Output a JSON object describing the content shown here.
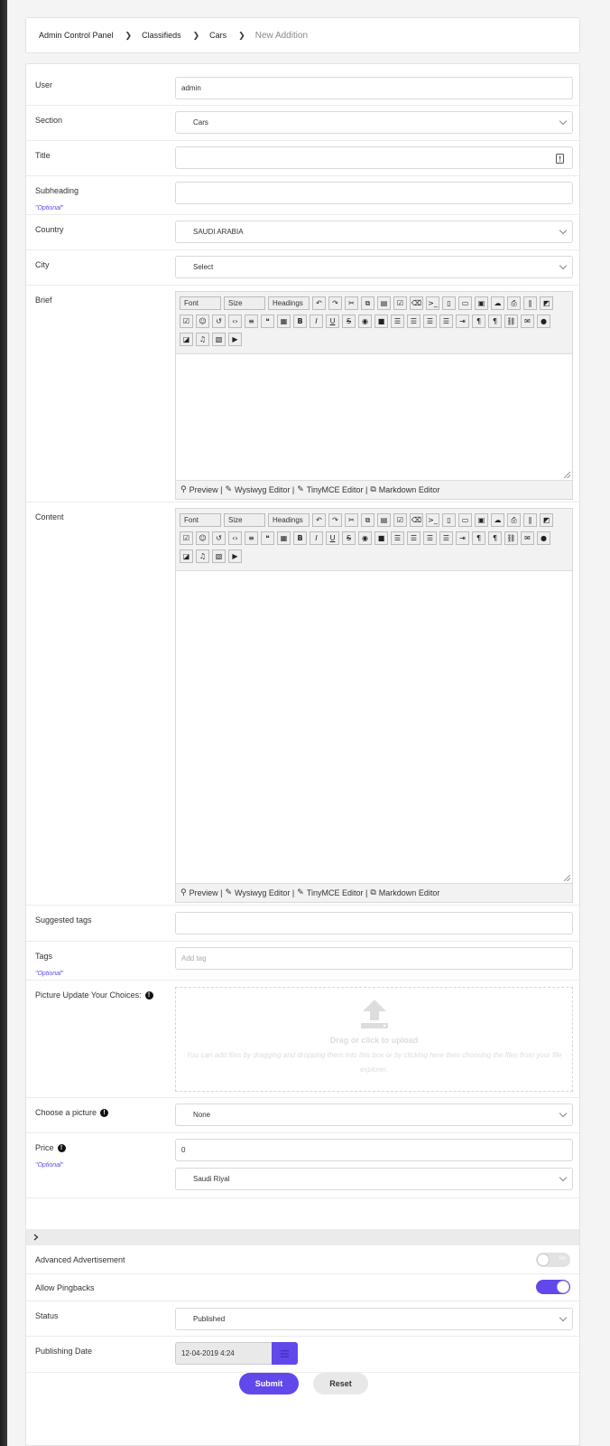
{
  "breadcrumb": {
    "items": [
      "Admin Control Panel",
      "Classifieds",
      "Cars"
    ],
    "current": "New Addition"
  },
  "form": {
    "user": {
      "label": "User",
      "value": "admin"
    },
    "section": {
      "label": "Section",
      "value": "Cars"
    },
    "title": {
      "label": "Title",
      "value": ""
    },
    "subheading": {
      "label": "Subheading",
      "optional": "\"Optional\"",
      "value": ""
    },
    "country": {
      "label": "Country",
      "value": "SAUDI ARABIA"
    },
    "city": {
      "label": "City",
      "value": "Select"
    },
    "brief": {
      "label": "Brief"
    },
    "content": {
      "label": "Content"
    },
    "suggested_tags": {
      "label": "Suggested tags",
      "value": ""
    },
    "tags": {
      "label": "Tags",
      "optional": "\"Optional\"",
      "placeholder": "Add tag"
    },
    "picture_upload": {
      "label": "Picture Update Your Choices:",
      "title": "Drag or click to upload",
      "description": "You can add files by dragging and dropping them into this box or by clicking here then choosing the files from your file explorer."
    },
    "choose_picture": {
      "label": "Choose a picture",
      "value": "None"
    },
    "price": {
      "label": "Price",
      "optional": "\"Optional\"",
      "value": "0",
      "currency": "Saudi Riyal"
    },
    "advanced_ad": {
      "label": "Advanced Advertisement",
      "toggle_text": "No",
      "state": "off"
    },
    "pingbacks": {
      "label": "Allow Pingbacks",
      "state": "on"
    },
    "status": {
      "label": "Status",
      "value": "Published"
    },
    "publishing_date": {
      "label": "Publishing Date",
      "value": "12-04-2019 4:24"
    }
  },
  "editor": {
    "dropdowns": [
      "Font",
      "Size",
      "Headings"
    ],
    "icons": [
      "undo-icon",
      "redo-icon",
      "cut-icon",
      "copy-icon",
      "paste-icon",
      "paste-text-icon",
      "eraser-icon",
      "code-view-icon",
      "file-icon",
      "frame-icon",
      "image-icon",
      "upload-icon",
      "print-icon",
      "attach-icon",
      "image-edit-icon",
      "check-square-icon",
      "emoji-icon",
      "history-icon",
      "code-icon",
      "list-icon",
      "quote-icon",
      "qrcode-icon",
      "bold-icon",
      "italic-icon",
      "underline-icon",
      "strikethrough-icon",
      "palette-icon",
      "block-icon",
      "align-right-icon",
      "align-center-icon",
      "align-left-icon",
      "justify-icon",
      "indent-icon",
      "ltr-icon",
      "rtl-icon",
      "link-icon",
      "envelope-icon",
      "comment-icon",
      "image2-icon",
      "music-icon",
      "film-icon",
      "youtube-icon"
    ],
    "footer": {
      "preview": "Preview |",
      "wysiwyg": "Wysiwyg Editor |",
      "tinymce": "TinyMCE Editor |",
      "markdown": "Markdown Editor"
    }
  },
  "actions": {
    "submit": "Submit",
    "reset": "Reset"
  }
}
